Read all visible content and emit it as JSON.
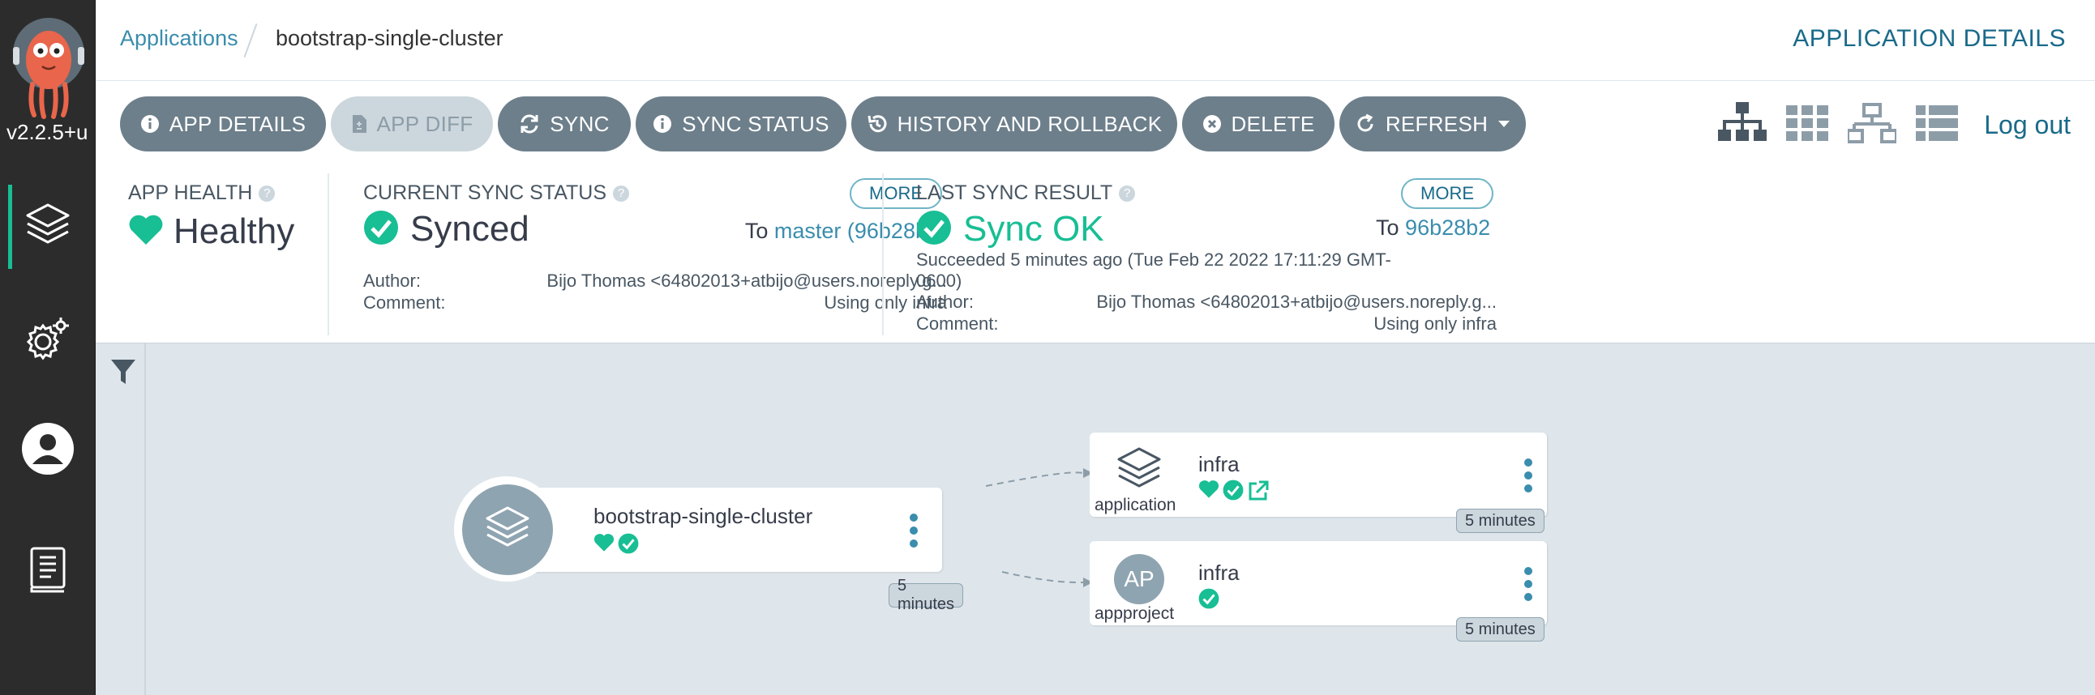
{
  "sidebar": {
    "version": "v2.2.5+u",
    "items": [
      {
        "name": "applications-icon"
      },
      {
        "name": "settings-icon"
      },
      {
        "name": "user-info-icon"
      },
      {
        "name": "documentation-icon"
      }
    ]
  },
  "header": {
    "breadcrumb_root": "Applications",
    "breadcrumb_current": "bootstrap-single-cluster",
    "title": "APPLICATION DETAILS"
  },
  "toolbar": {
    "app_details": "APP DETAILS",
    "app_diff": "APP DIFF",
    "sync": "SYNC",
    "sync_status": "SYNC STATUS",
    "history": "HISTORY AND ROLLBACK",
    "delete": "DELETE",
    "refresh": "REFRESH",
    "logout": "Log out"
  },
  "app_health": {
    "label": "APP HEALTH",
    "value": "Healthy"
  },
  "current_sync": {
    "label": "CURRENT SYNC STATUS",
    "more": "MORE",
    "value": "Synced",
    "to_prefix": "To",
    "to_rev": "master (96b28b2)",
    "author_label": "Author:",
    "author": "Bijo Thomas <64802013+atbijo@users.noreply.g...",
    "comment_label": "Comment:",
    "comment": "Using only infra"
  },
  "last_sync": {
    "label": "LAST SYNC RESULT",
    "more": "MORE",
    "value": "Sync OK",
    "to_prefix": "To",
    "to_rev": "96b28b2",
    "succeeded_line1": "Succeeded 5 minutes ago (Tue Feb 22 2022 17:11:29 GMT-",
    "succeeded_line2": "0600)",
    "author_label": "Author:",
    "author": "Bijo Thomas <64802013+atbijo@users.noreply.g...",
    "comment_label": "Comment:",
    "comment": "Using only infra"
  },
  "graph": {
    "root": {
      "name": "bootstrap-single-cluster",
      "age": "5 minutes"
    },
    "children": [
      {
        "name": "infra",
        "kind": "application",
        "age": "5 minutes"
      },
      {
        "name": "infra",
        "kind": "appproject",
        "abbr": "AP",
        "age": "5 minutes"
      }
    ]
  },
  "colors": {
    "healthy": "#18be94",
    "link": "#3a8dad",
    "button": "#6d7f8b",
    "sidebar": "#2c2c2c",
    "canvas": "#dee6eb"
  }
}
